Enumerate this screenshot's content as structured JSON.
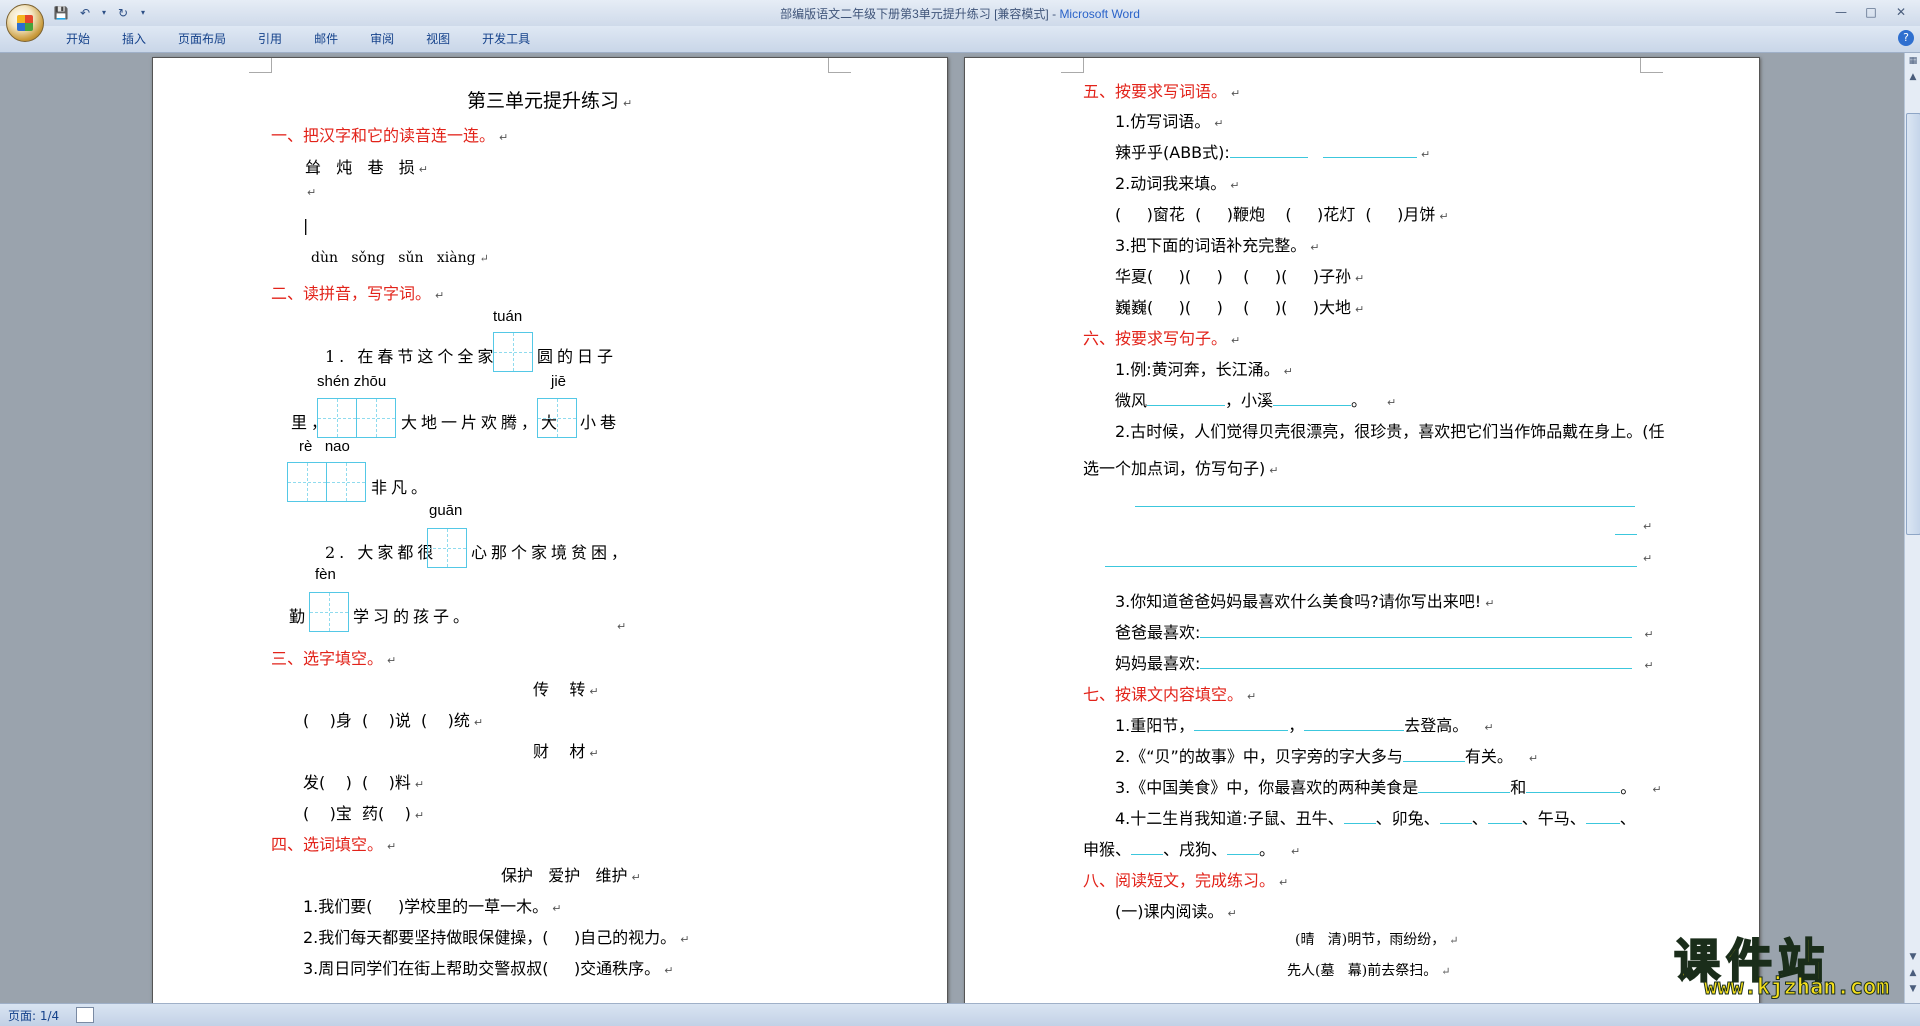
{
  "window": {
    "title_doc": "部编版语文二年级下册第3单元提升练习 [兼容模式] - ",
    "title_app": "Microsoft Word"
  },
  "ribbon": {
    "tabs": [
      "开始",
      "插入",
      "页面布局",
      "引用",
      "邮件",
      "审阅",
      "视图",
      "开发工具"
    ]
  },
  "status": {
    "page": "页面: 1/4"
  },
  "logo": {
    "text": "课件站",
    "url": "www.kjzhan.com"
  },
  "page1": {
    "title": "第三单元提升练习",
    "s1": {
      "heading": "一、把汉字和它的读音连一连。",
      "chars": "耸   炖   巷   损",
      "pinyin": "dùn   sǒng   sǔn   xiàng"
    },
    "s2": {
      "heading": "二、读拼音，写字词。",
      "py_tuan": "tuán",
      "l1a": "1. 在春节这个全家",
      "l1b": "圆的日子",
      "py_shenzhou": "shén zhōu",
      "py_jie": "jiē",
      "l2a": "里，",
      "l2b": "大地一片欢腾，大",
      "l2c": "小巷",
      "py_renao": "rè   nao",
      "l3": "非凡。",
      "py_guan": "guān",
      "l4a": "2. 大家都很",
      "l4b": "心那个家境贫困，",
      "py_fen": "fèn",
      "l5a": "勤",
      "l5b": "学习的孩子。"
    },
    "s3": {
      "heading": "三、选字填空。",
      "pair1": "传    转",
      "row1": "(    )身  (    )说  (    )统",
      "pair2": "财    材",
      "row2": "发(    )  (    )料",
      "row3": "(    )宝  药(    )"
    },
    "s4": {
      "heading": "四、选词填空。",
      "words": "保护   爱护   维护",
      "q1": "1.我们要(     )学校里的一草一木。",
      "q2": "2.我们每天都要坚持做眼保健操，(     )自己的视力。",
      "q3": "3.周日同学们在街上帮助交警叔叔(     )交通秩序。"
    }
  },
  "page2": {
    "s5": {
      "heading": "五、按要求写词语。",
      "q1": "1.仿写词语。",
      "q1a": "辣乎乎(ABB式):",
      "q2": "2.动词我来填。",
      "q2a": "(     )窗花  (     )鞭炮    (     )花灯  (     )月饼",
      "q3": "3.把下面的词语补充完整。",
      "q3a": "华夏(     )(     )    (     )(     )子孙",
      "q3b": "巍巍(     )(     )    (     )(     )大地"
    },
    "s6": {
      "heading": "六、按要求写句子。",
      "q1": "1.例:黄河奔，长江涌。",
      "q1a": "微风",
      "q1b": "，小溪",
      "q1c": "。",
      "q2": "2.古时候，人们觉得贝壳很漂亮，很珍贵，喜欢把它们当作饰品戴在身上。(任",
      "q2b": "选一个加点词，仿写句子)",
      "q3": "3.你知道爸爸妈妈最喜欢什么美食吗?请你写出来吧!",
      "q3a": "爸爸最喜欢:",
      "q3b": "妈妈最喜欢:"
    },
    "s7": {
      "heading": "七、按课文内容填空。",
      "q1a": "1.重阳节，",
      "q1b": "，",
      "q1c": "去登高。",
      "q2a": "2.《“贝”的故事》中，贝字旁的字大多与",
      "q2b": "有关。",
      "q3a": "3.《中国美食》中，你最喜欢的两种美食是",
      "q3b": "和",
      "q3c": "。",
      "q4a": "4.十二生肖我知道:子鼠、丑牛、",
      "q4b": "、卯兔、",
      "q4c": "、",
      "q4d": "、午马、",
      "q4e": "、",
      "q4f": "申猴、",
      "q4g": "、戌狗、",
      "q4h": "。"
    },
    "s8": {
      "heading": "八、阅读短文，完成练习。",
      "sub": "(一)课内阅读。",
      "poem1": "(晴   清)明节，雨纷纷，",
      "poem2": "先人(墓   幕)前去祭扫。"
    }
  }
}
